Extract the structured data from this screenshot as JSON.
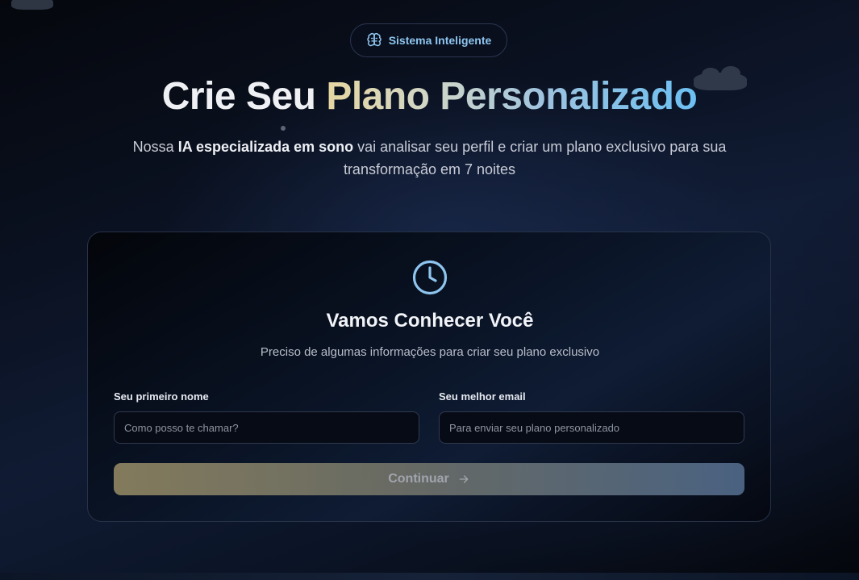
{
  "badge": {
    "icon": "brain-icon",
    "label": "Sistema Inteligente"
  },
  "hero": {
    "title_part1": "Crie Seu ",
    "title_part2": "Plano Personalizado",
    "subtitle_pre": "Nossa ",
    "subtitle_bold": "IA especializada em sono",
    "subtitle_post": " vai analisar seu perfil e criar um plano exclusivo para sua transformação em 7 noites"
  },
  "card": {
    "icon": "clock-icon",
    "title": "Vamos Conhecer Você",
    "subtitle": "Preciso de algumas informações para criar seu plano exclusivo",
    "fields": {
      "name": {
        "label": "Seu primeiro nome",
        "placeholder": "Como posso te chamar?",
        "value": ""
      },
      "email": {
        "label": "Seu melhor email",
        "placeholder": "Para enviar seu plano personalizado",
        "value": ""
      }
    },
    "continue_button": {
      "label": "Continuar",
      "icon": "arrow-right-icon"
    }
  },
  "colors": {
    "accent_blue": "#8ec5ef",
    "gradient_gold": "#e6d6a2",
    "gradient_blue": "#6cc0f2"
  }
}
